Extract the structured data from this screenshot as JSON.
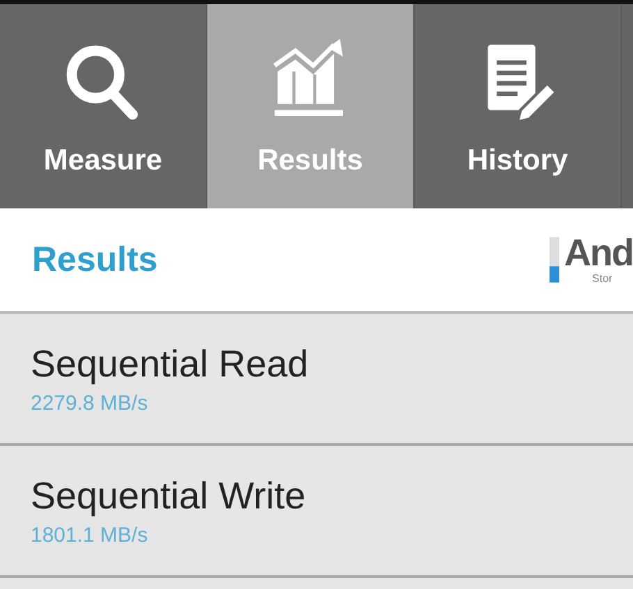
{
  "tabs": [
    {
      "label": "Measure",
      "kind": "search",
      "selected": false
    },
    {
      "label": "Results",
      "kind": "chart",
      "selected": true
    },
    {
      "label": "History",
      "kind": "document",
      "selected": false
    }
  ],
  "header": {
    "title": "Results",
    "logo": {
      "text": "And",
      "subtitle": "Stor"
    }
  },
  "results": [
    {
      "name": "Sequential Read",
      "value": "2279.8 MB/s"
    },
    {
      "name": "Sequential Write",
      "value": "1801.1 MB/s"
    }
  ]
}
